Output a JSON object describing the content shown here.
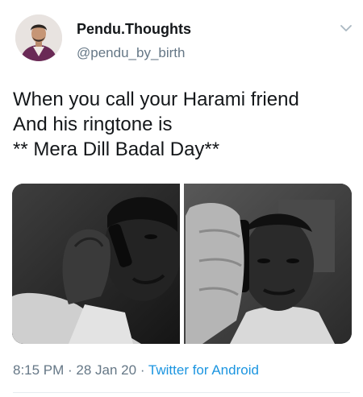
{
  "author": {
    "display_name": "Pendu.Thoughts",
    "handle": "@pendu_by_birth",
    "avatar_icon": "profile-photo"
  },
  "tweet": {
    "lines": [
      "When you call your Harami friend",
      "And his ringtone is",
      "** Mera Dill Badal Day**"
    ],
    "media_icon": "meme-photo-two-panels"
  },
  "meta": {
    "time": "8:15 PM",
    "separator": " · ",
    "date": "28 Jan 20",
    "source": "Twitter for Android"
  },
  "colors": {
    "text": "#14171a",
    "secondary": "#657786",
    "link": "#1b95e0"
  }
}
